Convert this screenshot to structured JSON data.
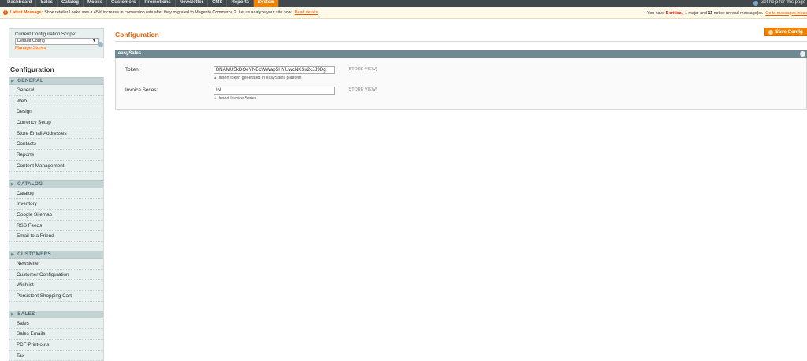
{
  "topnav": {
    "items": [
      "Dashboard",
      "Sales",
      "Catalog",
      "Mobile",
      "Customers",
      "Promotions",
      "Newsletter",
      "CMS",
      "Reports",
      "System"
    ],
    "active_index": 9,
    "help_text": "Get help for this page"
  },
  "notice": {
    "label": "Latest Message:",
    "message": "Shoe retailer Loake saw a 45% increase in conversion rate after they migrated to Magento Commerce 2. Let us analyze your site now.",
    "link": "Read details",
    "right_prefix": "You have",
    "critical_count": "5 critical",
    "major_text": "1 major and",
    "notice_count": "11",
    "right_suffix": "notice unread message(s).",
    "right_link": "Go to messages inbox"
  },
  "scope": {
    "label": "Current Configuration Scope:",
    "selected": "Default Config",
    "manage_link": "Manage Stores"
  },
  "sidebar": {
    "title": "Configuration",
    "groups": [
      {
        "title": "GENERAL",
        "items": [
          "General",
          "Web",
          "Design",
          "Currency Setup",
          "Store Email Addresses",
          "Contacts",
          "Reports",
          "Content Management"
        ]
      },
      {
        "title": "CATALOG",
        "items": [
          "Catalog",
          "Inventory",
          "Google Sitemap",
          "RSS Feeds",
          "Email to a Friend"
        ]
      },
      {
        "title": "CUSTOMERS",
        "items": [
          "Newsletter",
          "Customer Configuration",
          "Wishlist",
          "Persistent Shopping Cart"
        ]
      },
      {
        "title": "SALES",
        "items": [
          "Sales",
          "Sales Emails",
          "PDF Print-outs",
          "Tax"
        ]
      }
    ]
  },
  "main": {
    "title": "Configuration",
    "save_label": "Save Config",
    "section_title": "easySales",
    "fields": {
      "token": {
        "label": "Token:",
        "value": "BNAMU5kDOeYNBcWWap5HYUwcNKSx2cJJ9Dg",
        "note": "Insert token generated in easySales platform",
        "scope": "[STORE VIEW]"
      },
      "invoice": {
        "label": "Invoice Series:",
        "value": "IN",
        "note": "Insert Invoice Series",
        "scope": "[STORE VIEW]"
      }
    }
  },
  "colors": {
    "accent": "#f18200",
    "title_orange": "#eb5e00",
    "nav_bg": "#42494d",
    "sidebar_bg": "#e7efef",
    "section_head": "#6f8992"
  }
}
